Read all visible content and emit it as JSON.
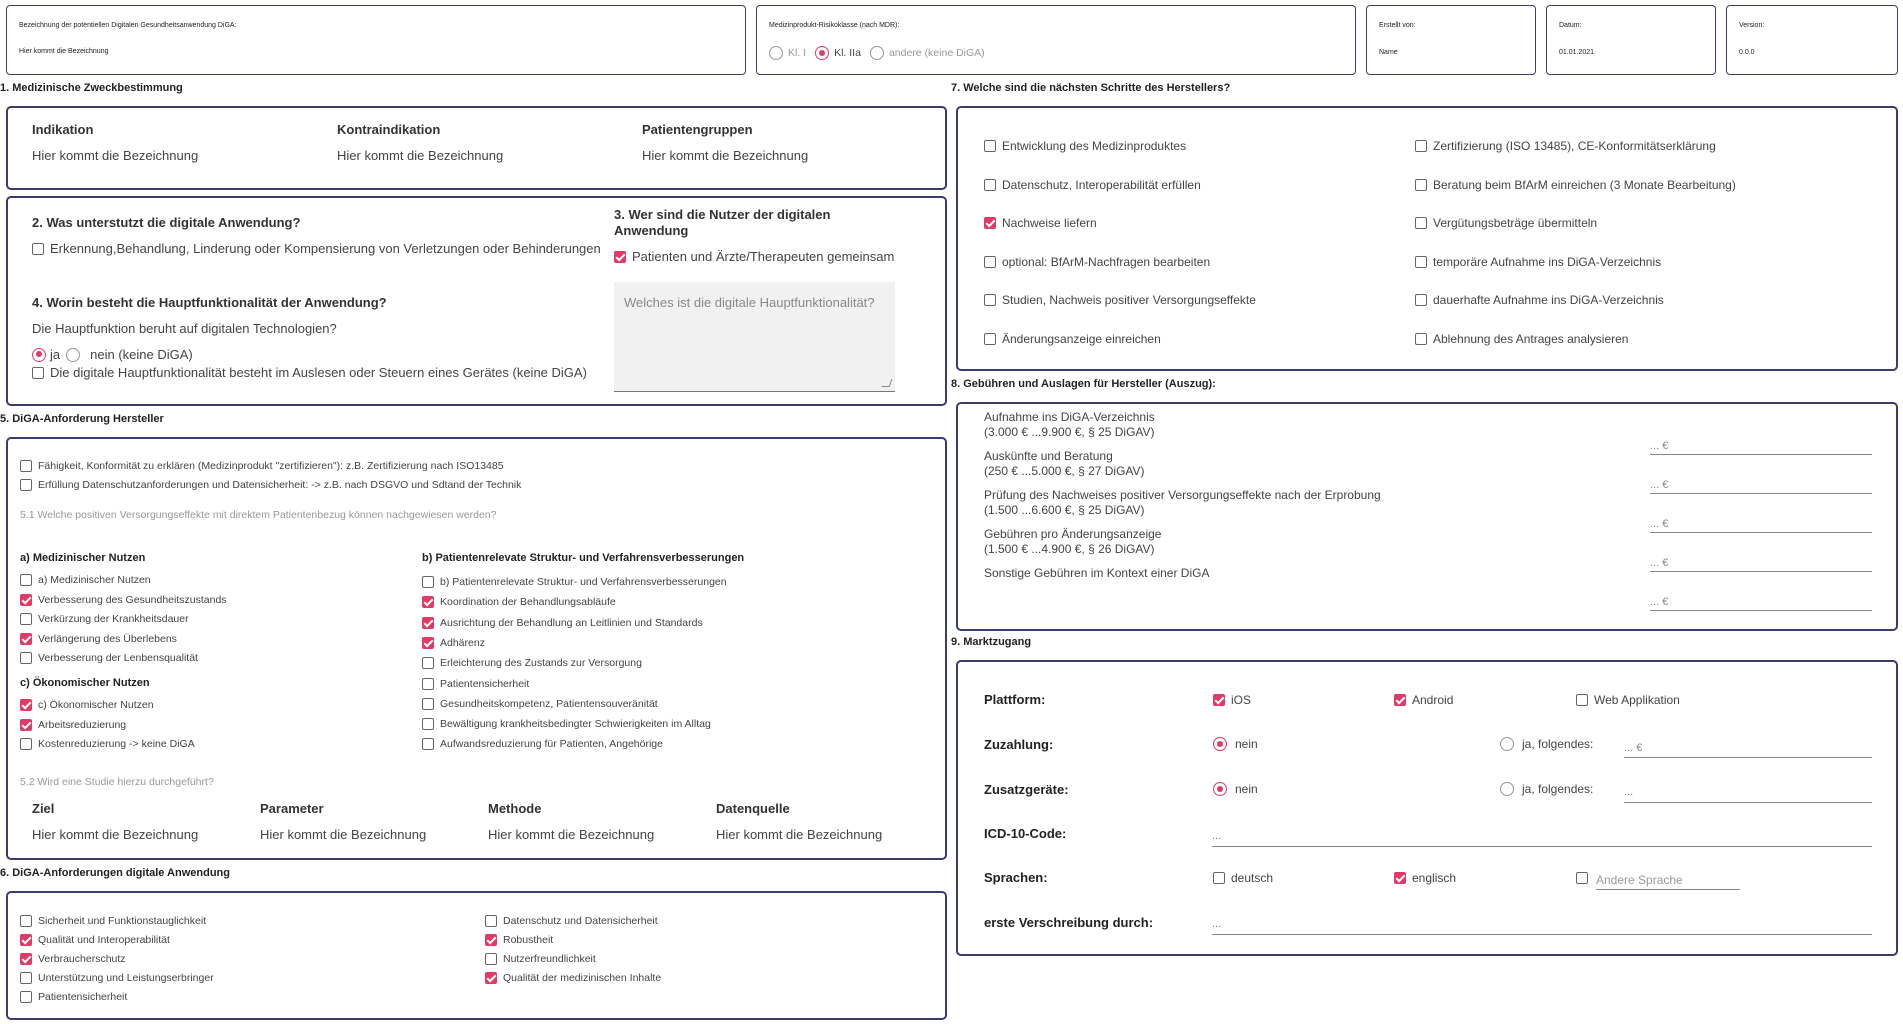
{
  "header": {
    "name_label": "Bezeichnung der potentiellen Digitalen Gesundheitsanwendung DiGA:",
    "name_value": "Hier kommt die Bezeichnung",
    "risk_label": "Medizinprodukt-Risikoklasse (nach MDR):",
    "risk_options": [
      "Kl. I",
      "Kl. IIa",
      "andere (keine DiGA)"
    ],
    "risk_selected": "Kl. IIa",
    "created_label": "Erstellt von:",
    "created_value": "Name",
    "date_label": "Datum:",
    "date_value": "01.01.2021",
    "version_label": "Version:",
    "version_value": "0.0.0"
  },
  "s1": {
    "title": "1. Medizinische Zweckbestimmung",
    "cols": [
      {
        "heading": "Indikation",
        "value": "Hier kommt die Bezeichnung"
      },
      {
        "heading": "Kontraindikation",
        "value": "Hier kommt die Bezeichnung"
      },
      {
        "heading": "Patientengruppen",
        "value": "Hier kommt die Bezeichnung"
      }
    ]
  },
  "s2": {
    "title": "2. Was unterstutzt die digitale Anwendung?",
    "option": "Erkennung,Behandlung, Linderung oder Kompensierung von Verletzungen oder Behinderungen"
  },
  "s3": {
    "title": "3. Wer sind die Nutzer der digitalen Anwendung",
    "option": "Patienten und Ärzte/Therapeuten gemeinsam"
  },
  "s4": {
    "title": "4. Worin besteht die Hauptfunktionalität der Anwendung?",
    "question": "Die Hauptfunktion beruht auf digitalen Technologien?",
    "yes": "ja",
    "no": "nein (keine DiGA)",
    "option": "Die digitale Hauptfunktionalität besteht im Auslesen oder Steuern eines Gerätes (keine DiGA)",
    "textarea_placeholder": "Welches ist die digitale Hauptfunktionalität?"
  },
  "s5": {
    "title": "5. DiGA-Anforderung Hersteller",
    "req1": "Fähigkeit, Konformität zu erklären (Medizinprodukt \"zertifizieren\"): z.B. Zertifizierung nach ISO13485",
    "req2": "Erfüllung Datenschutzanforderungen und Datensicherheit: -> z.B. nach DSGVO und Sdtand der Technik",
    "q51": "5.1 Welche positiven Versorgungseffekte mit direktem Patientenbezug können nachgewiesen werden?",
    "a_title": "a) Medizinischer Nutzen",
    "a_items": [
      {
        "label": "a) Medizinischer Nutzen",
        "checked": false
      },
      {
        "label": "Verbesserung des Gesundheitszustands",
        "checked": true
      },
      {
        "label": "Verkürzung der Krankheitsdauer",
        "checked": false
      },
      {
        "label": "Verlängerung des Überlebens",
        "checked": true
      },
      {
        "label": "Verbesserung der Lenbensqualität",
        "checked": false
      }
    ],
    "c_title": "c) Ökonomischer Nutzen",
    "c_items": [
      {
        "label": "c) Ökonomischer Nutzen",
        "checked": true
      },
      {
        "label": "Arbeitsreduzierung",
        "checked": true
      },
      {
        "label": "Kostenreduzierung -> keine DiGA",
        "checked": false
      }
    ],
    "b_title": "b) Patientenrelevate Struktur- und Verfahrensverbesserungen",
    "b_items": [
      {
        "label": "b) Patientenrelevate Struktur- und Verfahrensverbesserungen",
        "checked": false
      },
      {
        "label": "Koordination der Behandlungsabläufe",
        "checked": true
      },
      {
        "label": "Ausrichtung der Behandlung an Leitlinien und Standards",
        "checked": true
      },
      {
        "label": "Adhärenz",
        "checked": true
      },
      {
        "label": "Erleichterung des Zustands zur Versorgung",
        "checked": false
      },
      {
        "label": "Patientensicherheit",
        "checked": false
      },
      {
        "label": "Gesundheitskompetenz, Patientensouveränität",
        "checked": false
      },
      {
        "label": "Bewältigung krankheitsbedingter Schwierigkeiten im Alltag",
        "checked": false
      },
      {
        "label": "Aufwandsreduzierung für Patienten, Angehörige",
        "checked": false
      }
    ],
    "q52": "5.2 Wird eine Studie hierzu durchgeführt?",
    "study_cols": [
      {
        "heading": "Ziel",
        "value": "Hier kommt die Bezeichnung"
      },
      {
        "heading": "Parameter",
        "value": "Hier kommt die Bezeichnung"
      },
      {
        "heading": "Methode",
        "value": "Hier kommt die Bezeichnung"
      },
      {
        "heading": "Datenquelle",
        "value": "Hier kommt die Bezeichnung"
      }
    ]
  },
  "s6": {
    "title": "6. DiGA-Anforderungen digitale Anwendung",
    "left": [
      {
        "label": "Sicherheit und Funktionstauglichkeit",
        "checked": false
      },
      {
        "label": "Qualität und Interoperabilität",
        "checked": true
      },
      {
        "label": "Verbraucherschutz",
        "checked": true
      },
      {
        "label": "Unterstützung und Leistungserbringer",
        "checked": false
      },
      {
        "label": "Patientensicherheit",
        "checked": false
      }
    ],
    "right": [
      {
        "label": "Datenschutz und Datensicherheit",
        "checked": false
      },
      {
        "label": "Robustheit",
        "checked": true
      },
      {
        "label": "Nutzerfreundlichkeit",
        "checked": false
      },
      {
        "label": "Qualität der medizinischen Inhalte",
        "checked": true
      }
    ]
  },
  "s7": {
    "title": "7. Welche sind die nächsten Schritte des Herstellers?",
    "left": [
      {
        "label": "Entwicklung des Medizinproduktes",
        "checked": false
      },
      {
        "label": "Datenschutz, Interoperabilität erfüllen",
        "checked": false
      },
      {
        "label": "Nachweise liefern",
        "checked": true
      },
      {
        "label": "optional: BfArM-Nachfragen bearbeiten",
        "checked": false
      },
      {
        "label": "Studien, Nachweis positiver Versorgungseffekte",
        "checked": false
      },
      {
        "label": "Änderungsanzeige einreichen",
        "checked": false
      }
    ],
    "right": [
      {
        "label": "Zertifizierung (ISO 13485), CE-Konformitätserklärung",
        "checked": false
      },
      {
        "label": "Beratung beim BfArM einreichen (3 Monate Bearbeitung)",
        "checked": false
      },
      {
        "label": "Vergütungsbeträge übermitteln",
        "checked": false
      },
      {
        "label": "temporäre Aufnahme ins DiGA-Verzeichnis",
        "checked": false
      },
      {
        "label": "dauerhafte Aufnahme ins DiGA-Verzeichnis",
        "checked": false
      },
      {
        "label": "Ablehnung des Antrages analysieren",
        "checked": false
      }
    ]
  },
  "s8": {
    "title": "8. Gebühren und Auslagen für Hersteller (Auszug):",
    "fees": [
      {
        "line1": "Aufnahme ins DiGA-Verzeichnis",
        "line2": "(3.000 € ...9.900 €, § 25 DiGAV)",
        "placeholder": "... €"
      },
      {
        "line1": "Auskünfte und Beratung",
        "line2": "(250 € ...5.000 €, § 27 DiGAV)",
        "placeholder": "... €"
      },
      {
        "line1": "Prüfung des Nachweises positiver Versorgungseffekte nach der Erprobung",
        "line2": "(1.500 ...6.600 €, § 25 DiGAV)",
        "placeholder": "... €"
      },
      {
        "line1": "Gebühren pro Änderungsanzeige",
        "line2": "(1.500 € ...4.900 €, § 26 DiGAV)",
        "placeholder": "... €"
      },
      {
        "line1": "Sonstige Gebühren im Kontext einer DiGA",
        "line2": "",
        "placeholder": "... €"
      }
    ]
  },
  "s9": {
    "title": "9. Marktzugang",
    "platform_label": "Plattform:",
    "platforms": [
      {
        "label": "iOS",
        "checked": true
      },
      {
        "label": "Android",
        "checked": true
      },
      {
        "label": "Web Applikation",
        "checked": false
      }
    ],
    "copay_label": "Zuzahlung:",
    "copay_no": "nein",
    "copay_yes": "ja, folgendes:",
    "copay_placeholder": "... €",
    "devices_label": "Zusatzgeräte:",
    "devices_no": "nein",
    "devices_yes": "ja, folgendes:",
    "devices_placeholder": "...",
    "icd_label": "ICD-10-Code:",
    "icd_placeholder": "...",
    "lang_label": "Sprachen:",
    "languages": [
      {
        "label": "deutsch",
        "checked": false
      },
      {
        "label": "englisch",
        "checked": true
      }
    ],
    "lang_other_placeholder": "Andere Sprache",
    "first_rx_label": "erste Verschreibung durch:",
    "first_rx_placeholder": "..."
  }
}
